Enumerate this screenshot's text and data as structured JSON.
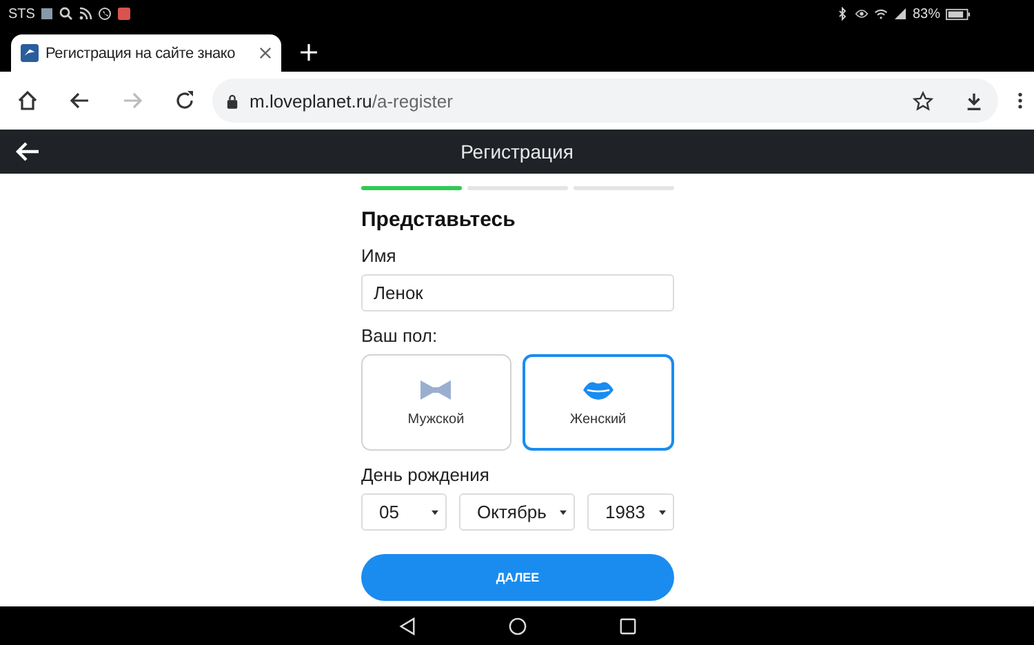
{
  "status_bar": {
    "carrier": "STS",
    "battery": "83%"
  },
  "browser": {
    "tab_title": "Регистрация на сайте знако",
    "url_host": "m.loveplanet.ru",
    "url_path": "/a-register",
    "forward_disabled": true
  },
  "header": {
    "title": "Регистрация"
  },
  "progress": [
    {
      "complete": true
    },
    {
      "complete": false
    },
    {
      "complete": false
    }
  ],
  "form": {
    "heading": "Представьтесь",
    "name_label": "Имя",
    "name_value": "Ленок",
    "gender_label": "Ваш пол:",
    "genders": [
      {
        "kind": "male",
        "label": "Мужской",
        "selected": false
      },
      {
        "kind": "female",
        "label": "Женский",
        "selected": true
      }
    ],
    "birthday_label": "День рождения",
    "birthday": [
      {
        "value": "05"
      },
      {
        "value": "Октябрь"
      },
      {
        "value": "1983"
      }
    ],
    "submit": "ДАЛЕЕ"
  }
}
